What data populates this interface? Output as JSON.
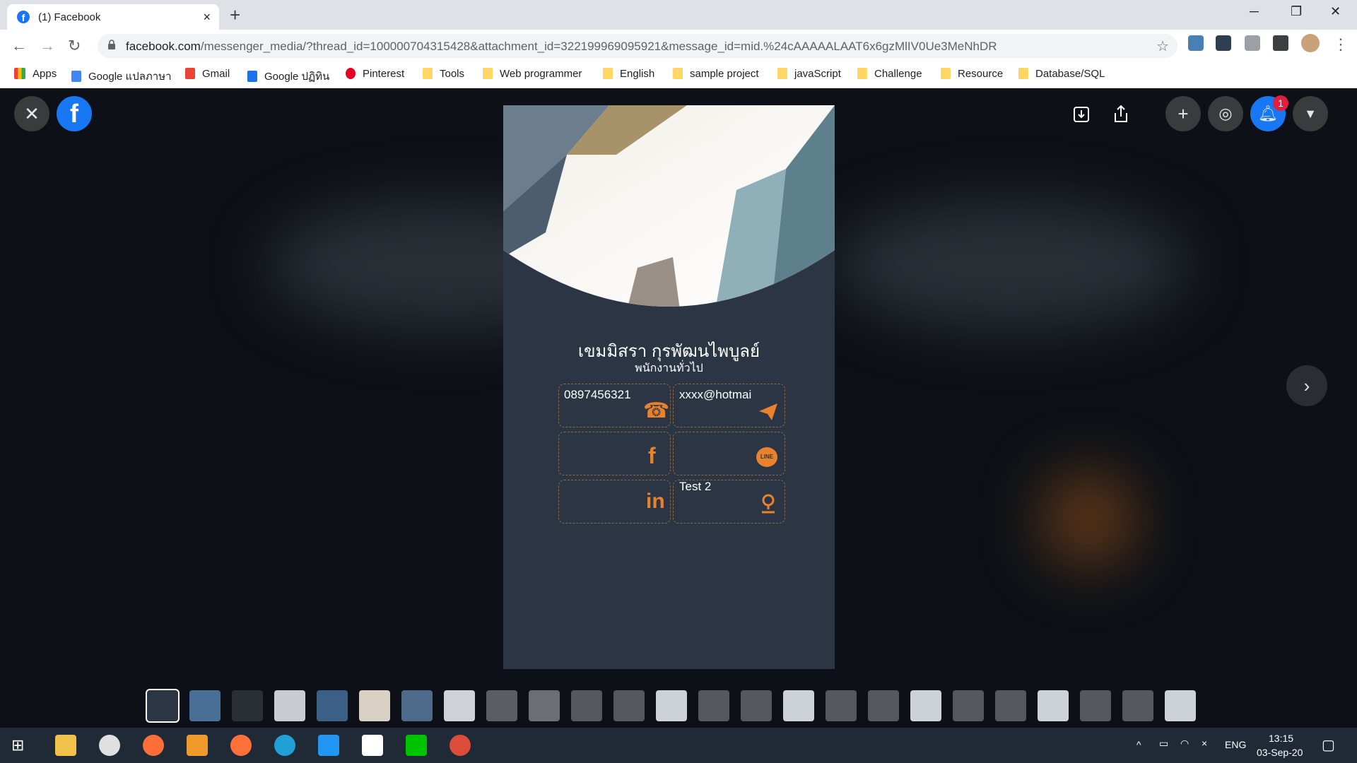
{
  "browser": {
    "tab_title": "(1) Facebook",
    "tab_close": "×",
    "new_tab": "+",
    "url_host": "facebook.com",
    "url_path": "/messenger_media/?thread_id=100000704315428&attachment_id=322199969095921&message_id=mid.%24cAAAAALAAT6x6gzMlIV0Ue3MeNhDR"
  },
  "bookmarks": [
    {
      "label": "Apps",
      "icon": "apps-grid-icon"
    },
    {
      "label": "Google แปลภาษา",
      "icon": "google-translate-icon"
    },
    {
      "label": "Gmail",
      "icon": "gmail-icon"
    },
    {
      "label": "Google ปฏิทิน",
      "icon": "google-calendar-icon"
    },
    {
      "label": "Pinterest",
      "icon": "pinterest-icon"
    },
    {
      "label": "Tools",
      "icon": "folder-icon"
    },
    {
      "label": "Web programmer",
      "icon": "folder-icon"
    },
    {
      "label": "English",
      "icon": "folder-icon"
    },
    {
      "label": "sample project",
      "icon": "folder-icon"
    },
    {
      "label": "javaScript",
      "icon": "folder-icon"
    },
    {
      "label": "Challenge",
      "icon": "folder-icon"
    },
    {
      "label": "Resource",
      "icon": "folder-icon"
    },
    {
      "label": "Database/SQL",
      "icon": "folder-icon"
    }
  ],
  "viewer": {
    "notification_count": "1",
    "card": {
      "name": "เขมมิสรา กุรพัฒนไพบูลย์",
      "position": "พนักงานทั่วไป",
      "phone": "0897456321",
      "email": "xxxx@hotmai",
      "address": "Test 2"
    },
    "thumbnail_count": 25
  },
  "taskbar": {
    "language": "ENG",
    "time": "13:15",
    "date": "03-Sep-20"
  },
  "colors": {
    "accent": "#1877f2",
    "card_bg": "#2b3544",
    "icon_orange": "#e8822d"
  }
}
